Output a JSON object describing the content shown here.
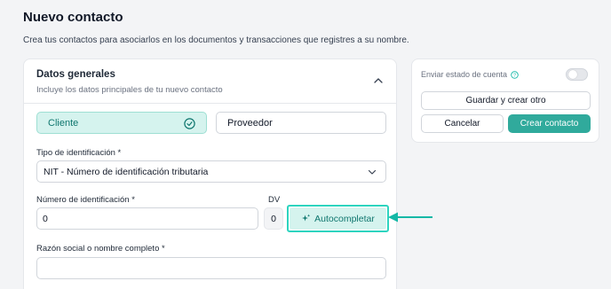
{
  "page": {
    "title": "Nuevo contacto",
    "subtitle": "Crea tus contactos para asociarlos en los documentos y transacciones que registres a su nombre."
  },
  "general": {
    "title": "Datos generales",
    "subtitle": "Incluye los datos principales de tu nuevo contacto",
    "contact_types": {
      "client": "Cliente",
      "supplier": "Proveedor",
      "selected": "Cliente"
    },
    "id_type": {
      "label": "Tipo de identificación *",
      "value": "NIT - Número de identificación tributaria"
    },
    "id_number": {
      "label": "Número de identificación *",
      "value": "0"
    },
    "dv": {
      "label": "DV",
      "value": "0"
    },
    "autocomplete_label": "Autocompletar",
    "business_name": {
      "label": "Razón social o nombre completo *",
      "value": ""
    }
  },
  "sidebar": {
    "send_statement_label": "Enviar estado de cuenta",
    "send_statement_enabled": false,
    "save_and_create_label": "Guardar y crear otro",
    "cancel_label": "Cancelar",
    "create_label": "Crear contacto"
  },
  "colors": {
    "accent": "#30aa9c",
    "accent_light": "#d5f3ee",
    "highlight": "#2dd4bf"
  },
  "icons": {
    "collapse": "chevron-up-icon",
    "selected": "check-circle-icon",
    "dropdown": "chevron-down-icon",
    "autocomplete": "sparkle-icon",
    "info": "info-icon",
    "annotation": "arrow-left-icon"
  }
}
